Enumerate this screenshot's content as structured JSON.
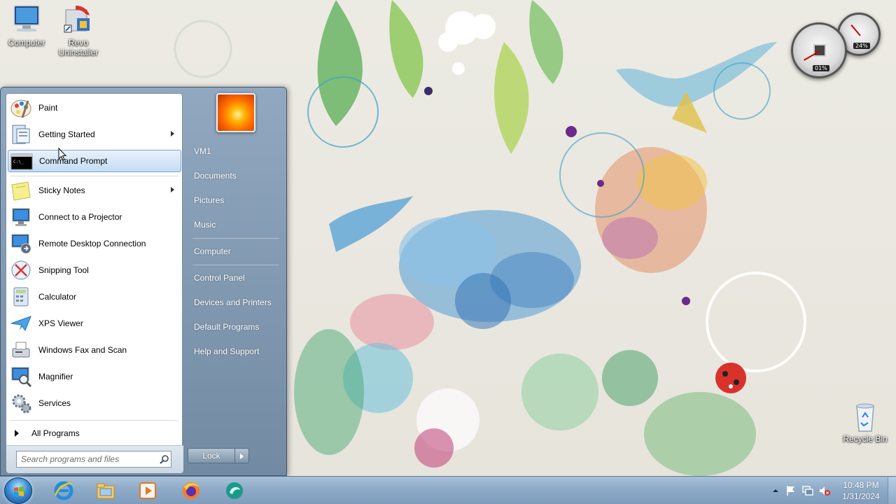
{
  "desktop": {
    "icons": [
      {
        "label": "Computer"
      },
      {
        "label": "Revo\nUninstaller"
      },
      {
        "label": "Recycle Bin"
      }
    ]
  },
  "gadget": {
    "cpu_percent": "01%",
    "ram_percent": "24%"
  },
  "start_menu": {
    "programs": [
      {
        "label": "Paint",
        "icon": "paint-icon",
        "submenu": false
      },
      {
        "label": "Getting Started",
        "icon": "getting-started-icon",
        "submenu": true
      },
      {
        "label": "Command Prompt",
        "icon": "command-prompt-icon",
        "submenu": false,
        "highlighted": true
      },
      {
        "label": "Sticky Notes",
        "icon": "sticky-notes-icon",
        "submenu": true
      },
      {
        "label": "Connect to a Projector",
        "icon": "projector-icon",
        "submenu": false
      },
      {
        "label": "Remote Desktop Connection",
        "icon": "remote-desktop-icon",
        "submenu": false
      },
      {
        "label": "Snipping Tool",
        "icon": "snipping-tool-icon",
        "submenu": false
      },
      {
        "label": "Calculator",
        "icon": "calculator-icon",
        "submenu": false
      },
      {
        "label": "XPS Viewer",
        "icon": "xps-viewer-icon",
        "submenu": false
      },
      {
        "label": "Windows Fax and Scan",
        "icon": "fax-scan-icon",
        "submenu": false
      },
      {
        "label": "Magnifier",
        "icon": "magnifier-icon",
        "submenu": false
      },
      {
        "label": "Services",
        "icon": "services-icon",
        "submenu": false
      }
    ],
    "all_programs": "All Programs",
    "search_placeholder": "Search programs and files",
    "right_items": [
      {
        "label": "VM1"
      },
      {
        "label": "Documents"
      },
      {
        "label": "Pictures"
      },
      {
        "label": "Music"
      },
      {
        "label": "Computer"
      },
      {
        "label": "Control Panel"
      },
      {
        "label": "Devices and Printers"
      },
      {
        "label": "Default Programs"
      },
      {
        "label": "Help and Support"
      }
    ],
    "lock_label": "Lock"
  },
  "taskbar": {
    "pinned": [
      {
        "name": "internet-explorer-icon"
      },
      {
        "name": "file-explorer-icon"
      },
      {
        "name": "media-player-icon"
      },
      {
        "name": "firefox-icon"
      },
      {
        "name": "app-icon"
      }
    ],
    "clock_time": "10:48 PM",
    "clock_date": "1/31/2024"
  }
}
